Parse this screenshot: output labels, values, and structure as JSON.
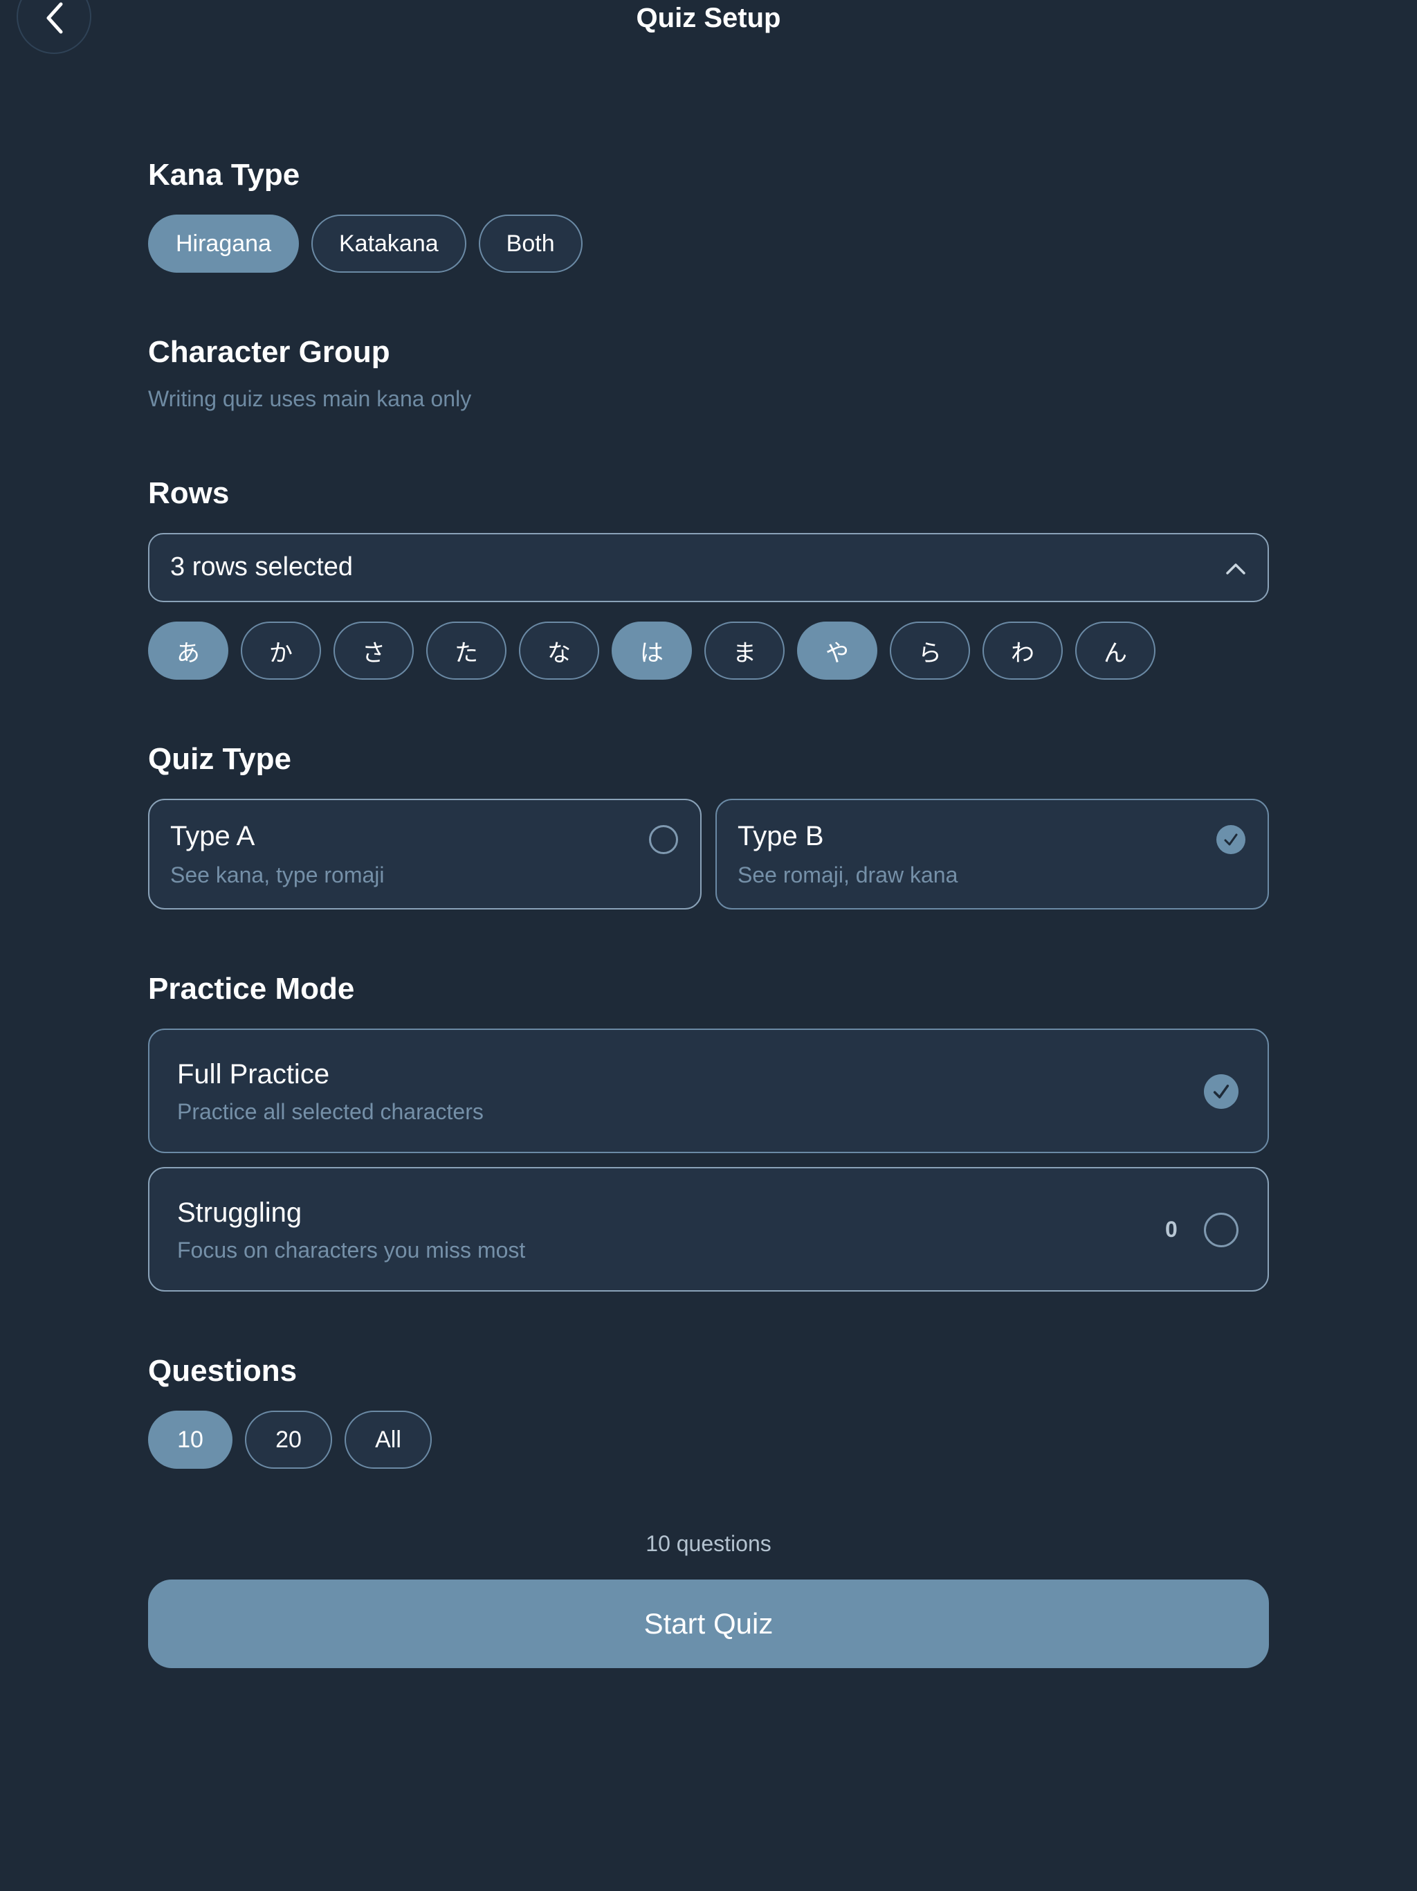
{
  "header": {
    "title": "Quiz Setup",
    "back_icon": "chevron-left-icon"
  },
  "kana_type": {
    "title": "Kana Type",
    "options": [
      "Hiragana",
      "Katakana",
      "Both"
    ],
    "selected": "Hiragana"
  },
  "character_group": {
    "title": "Character Group",
    "subtitle": "Writing quiz uses main kana only"
  },
  "rows": {
    "title": "Rows",
    "dropdown_value": "3 rows selected",
    "kana": [
      "あ",
      "か",
      "さ",
      "た",
      "な",
      "は",
      "ま",
      "や",
      "ら",
      "わ",
      "ん"
    ],
    "selected": [
      "あ",
      "は",
      "や"
    ]
  },
  "quiz_type": {
    "title": "Quiz Type",
    "options": [
      {
        "title": "Type A",
        "desc": "See kana, type romaji",
        "selected": false
      },
      {
        "title": "Type B",
        "desc": "See romaji, draw kana",
        "selected": true
      }
    ]
  },
  "practice_mode": {
    "title": "Practice Mode",
    "options": [
      {
        "title": "Full Practice",
        "desc": "Practice all selected characters",
        "selected": true,
        "count": ""
      },
      {
        "title": "Struggling",
        "desc": "Focus on characters you miss most",
        "selected": false,
        "count": "0"
      }
    ]
  },
  "questions": {
    "title": "Questions",
    "options": [
      "10",
      "20",
      "All"
    ],
    "selected": "10",
    "summary": "10 questions"
  },
  "start_button": {
    "label": "Start Quiz"
  },
  "colors": {
    "background": "#1e2a38",
    "accent": "#6b90ab",
    "card": "#243345",
    "muted_text": "#7590a8"
  }
}
